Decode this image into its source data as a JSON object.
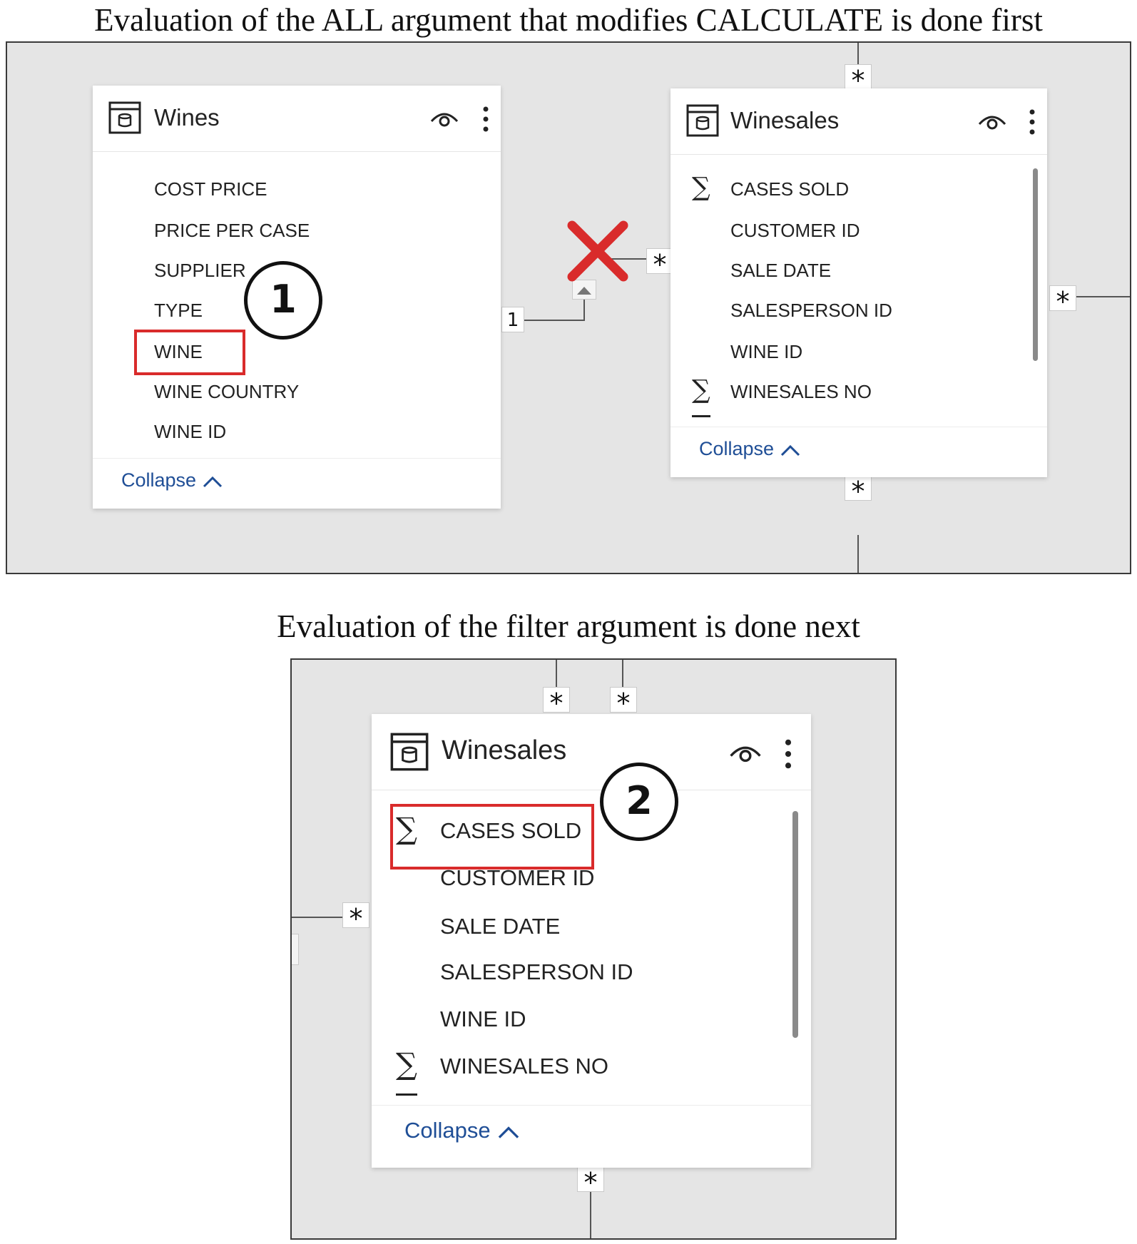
{
  "captions": {
    "top": "Evaluation of the ALL argument that modifies CALCULATE is done first",
    "bottom": "Evaluation of the filter argument is done next"
  },
  "panel1": {
    "wines_card": {
      "title": "Wines",
      "fields": [
        "COST PRICE",
        "PRICE PER CASE",
        "SUPPLIER",
        "TYPE",
        "WINE",
        "WINE COUNTRY",
        "WINE ID"
      ],
      "highlighted_field": "WINE",
      "collapse_label": "Collapse"
    },
    "winesales_card": {
      "title": "Winesales",
      "fields": [
        {
          "label": "CASES SOLD",
          "icon": "sigma-icon"
        },
        {
          "label": "CUSTOMER ID",
          "icon": ""
        },
        {
          "label": "SALE DATE",
          "icon": ""
        },
        {
          "label": "SALESPERSON ID",
          "icon": ""
        },
        {
          "label": "WINE ID",
          "icon": ""
        },
        {
          "label": "WINESALES NO",
          "icon": "sigma-icon"
        }
      ],
      "collapse_label": "Collapse"
    },
    "relationship": {
      "one_side": "1",
      "many_side": "*",
      "status": "disabled"
    },
    "other_markers": [
      "*",
      "*",
      "*"
    ],
    "step_badge": "1"
  },
  "panel2": {
    "winesales_card": {
      "title": "Winesales",
      "fields": [
        {
          "label": "CASES SOLD",
          "icon": "sigma-icon"
        },
        {
          "label": "CUSTOMER ID",
          "icon": ""
        },
        {
          "label": "SALE DATE",
          "icon": ""
        },
        {
          "label": "SALESPERSON ID",
          "icon": ""
        },
        {
          "label": "WINE ID",
          "icon": ""
        },
        {
          "label": "WINESALES NO",
          "icon": "sigma-icon"
        }
      ],
      "highlighted_field": "CASES SOLD",
      "collapse_label": "Collapse"
    },
    "markers": [
      "*",
      "*",
      "*",
      "*"
    ],
    "step_badge": "2"
  },
  "colors": {
    "canvas": "#e5e5e5",
    "highlight": "#d92b2b",
    "link": "#1f4e96",
    "connector": "#555555"
  }
}
